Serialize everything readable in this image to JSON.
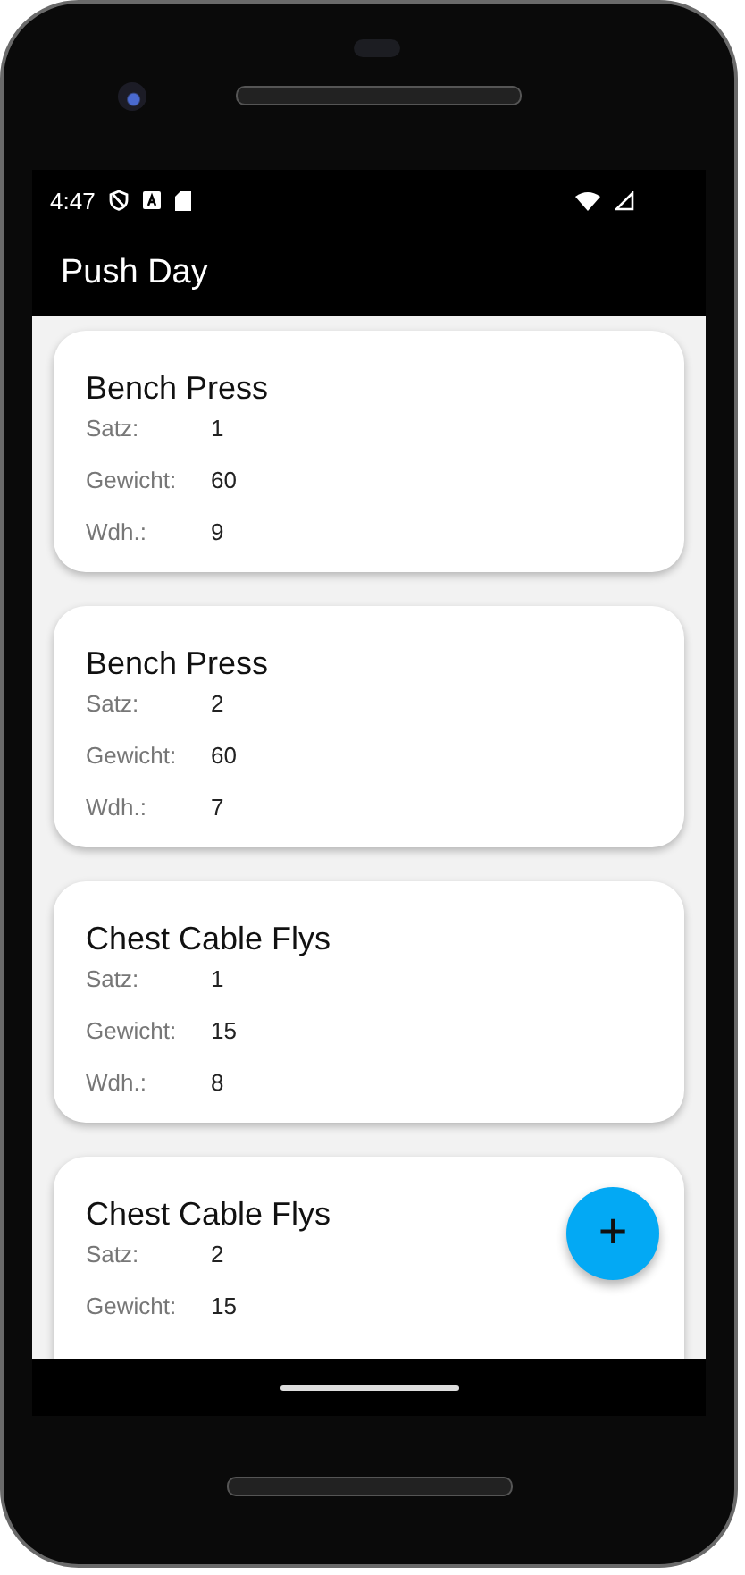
{
  "status_bar": {
    "time": "4:47"
  },
  "app_bar": {
    "title": "Push Day"
  },
  "sets": [
    {
      "exercise": "Bench Press",
      "fields": [
        {
          "label": "Satz:",
          "value": "1"
        },
        {
          "label": "Gewicht:",
          "value": "60"
        },
        {
          "label": "Wdh.:",
          "value": "9"
        }
      ]
    },
    {
      "exercise": "Bench Press",
      "fields": [
        {
          "label": "Satz:",
          "value": "2"
        },
        {
          "label": "Gewicht:",
          "value": "60"
        },
        {
          "label": "Wdh.:",
          "value": "7"
        }
      ]
    },
    {
      "exercise": "Chest Cable Flys",
      "fields": [
        {
          "label": "Satz:",
          "value": "1"
        },
        {
          "label": "Gewicht:",
          "value": "15"
        },
        {
          "label": "Wdh.:",
          "value": "8"
        }
      ]
    },
    {
      "exercise": "Chest Cable Flys",
      "fields": [
        {
          "label": "Satz:",
          "value": "2"
        },
        {
          "label": "Gewicht:",
          "value": "15"
        }
      ]
    }
  ],
  "fab": {
    "symbol": "+"
  }
}
